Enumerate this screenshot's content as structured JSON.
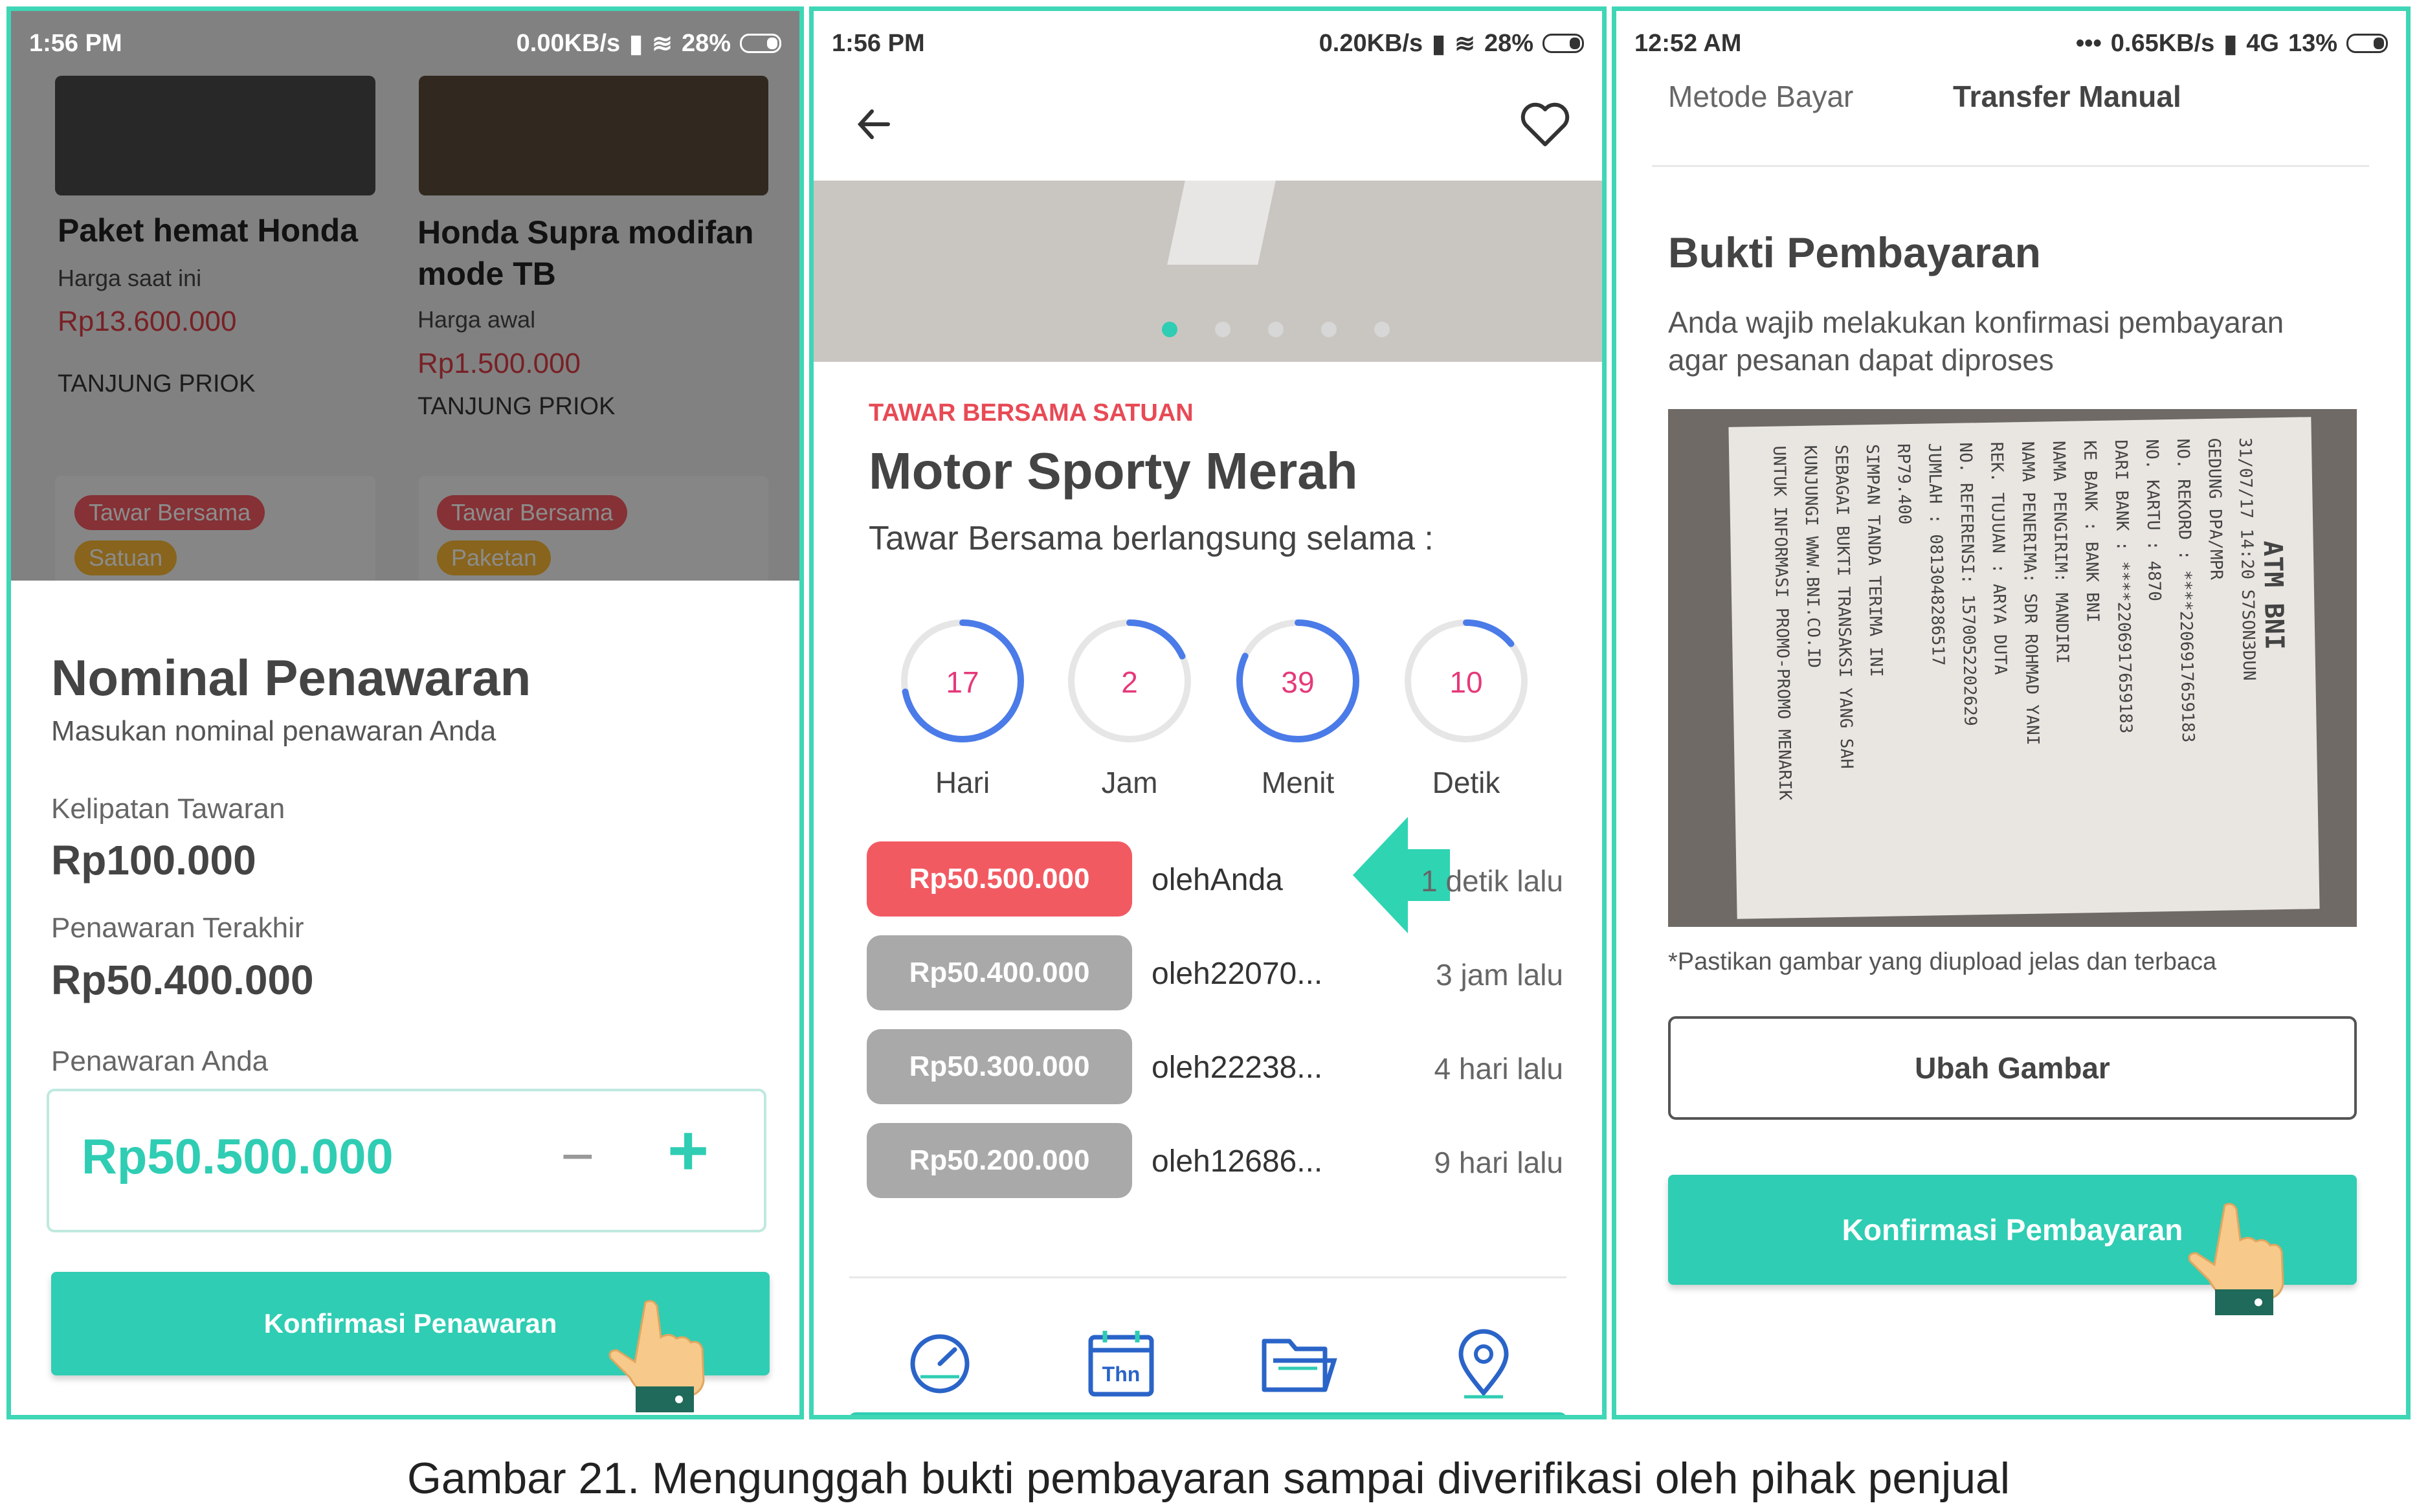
{
  "panel1": {
    "status": {
      "time": "1:56 PM",
      "speed": "0.00KB/s",
      "battery": "28%"
    },
    "products": [
      {
        "title": "Paket hemat Honda",
        "price_label": "Harga saat ini",
        "price": "Rp13.600.000",
        "location": "TANJUNG PRIOK"
      },
      {
        "title": "Honda Supra modifan mode TB",
        "price_label": "Harga awal",
        "price": "Rp1.500.000",
        "location": "TANJUNG PRIOK"
      }
    ],
    "tags": [
      {
        "label": "Tawar Bersama",
        "sub": "Satuan"
      },
      {
        "label": "Tawar Bersama",
        "sub": "Paketan"
      }
    ],
    "sheet": {
      "title": "Nominal Penawaran",
      "subtitle": "Masukan nominal penawaran Anda",
      "kelipatan_label": "Kelipatan Tawaran",
      "kelipatan_value": "Rp100.000",
      "terakhir_label": "Penawaran Terakhir",
      "terakhir_value": "Rp50.400.000",
      "anda_label": "Penawaran Anda",
      "anda_value": "Rp50.500.000",
      "minus": "−",
      "plus": "+",
      "confirm": "Konfirmasi Penawaran"
    }
  },
  "panel2": {
    "status": {
      "time": "1:56 PM",
      "speed": "0.20KB/s",
      "battery": "28%"
    },
    "category": "TAWAR BERSAMA SATUAN",
    "title": "Motor Sporty Merah",
    "subtitle": "Tawar Bersama berlangsung selama :",
    "countdown": [
      {
        "value": "17",
        "label": "Hari"
      },
      {
        "value": "2",
        "label": "Jam"
      },
      {
        "value": "39",
        "label": "Menit"
      },
      {
        "value": "10",
        "label": "Detik"
      }
    ],
    "bids": [
      {
        "amount": "Rp50.500.000",
        "by_prefix": "oleh",
        "by": "Anda",
        "time": "1 detik lalu",
        "highlight": true
      },
      {
        "amount": "Rp50.400.000",
        "by_prefix": "oleh",
        "by": "22070...",
        "time": "3 jam lalu",
        "highlight": false
      },
      {
        "amount": "Rp50.300.000",
        "by_prefix": "oleh",
        "by": "22238...",
        "time": "4 hari lalu",
        "highlight": false
      },
      {
        "amount": "Rp50.200.000",
        "by_prefix": "oleh",
        "by": "12686...",
        "time": "9 hari lalu",
        "highlight": false
      }
    ],
    "bottom_icons": [
      "speedometer-icon",
      "calendar-icon",
      "folder-icon",
      "location-pin-icon"
    ],
    "calendar_text": "Thn",
    "colors": {
      "teal": "#2fcdb3",
      "red": "#f25a62",
      "pink": "#e6397a",
      "blue": "#4a7be8",
      "gray": "#a9a9a9"
    }
  },
  "panel3": {
    "status": {
      "time": "12:52 AM",
      "speed": "0.65KB/s",
      "network": "4G",
      "battery": "13%"
    },
    "metode_label": "Metode Bayar",
    "metode_value": "Transfer Manual",
    "title": "Bukti Pembayaran",
    "description": "Anda wajib melakukan konfirmasi pembayaran agar pesanan dapat diproses",
    "receipt_lines": [
      "ATM BNI",
      "31/07/17   14:20   S7SON3DUN",
      "GEDUNG DPA/MPR",
      "NO. REKORD   : ****2206917659183",
      "NO. KARTU    : 4870",
      "DARI BANK    : ****2206917659183",
      "KE BANK      : BANK BNI",
      "NAMA PENGIRIM: MANDIRI",
      "NAMA PENERIMA: SDR ROHMAD YANI",
      "REK. TUJUAN  : ARYA DUTA",
      "NO. REFERENSI: 1570052202629",
      "JUMLAH       : 0813048286517",
      "                RP79.400",
      "SIMPAN TANDA TERIMA INI",
      "SEBAGAI BUKTI TRANSAKSI YANG SAH",
      "KUNJUNGI WWW.BNI.CO.ID",
      "UNTUK INFORMASI PROMO-PROMO MENARIK"
    ],
    "note": "*Pastikan gambar yang diupload jelas dan terbaca",
    "change_button": "Ubah Gambar",
    "confirm_button": "Konfirmasi Pembayaran"
  },
  "caption": "Gambar 21.  Mengunggah bukti pembayaran sampai diverifikasi oleh pihak penjual"
}
